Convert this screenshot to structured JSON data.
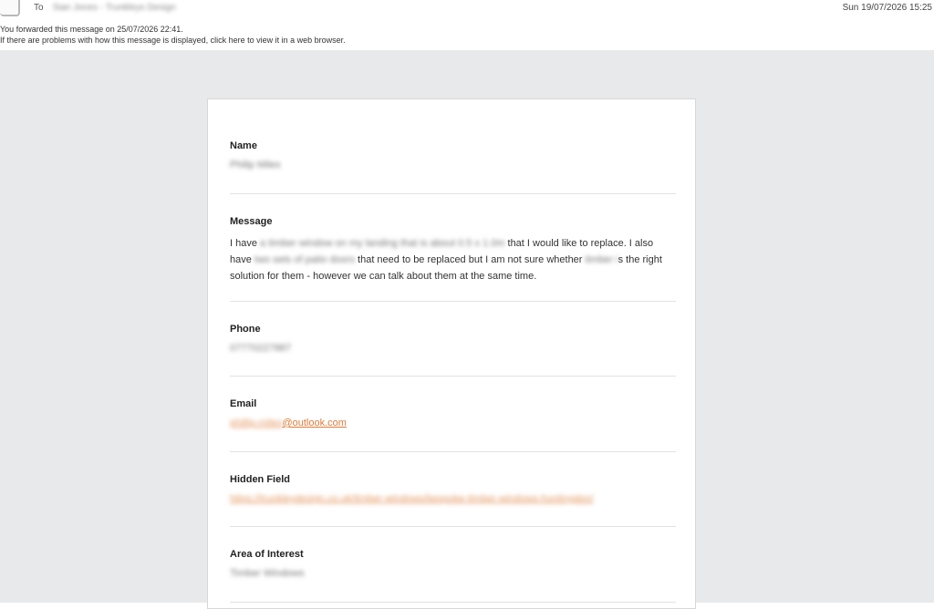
{
  "header": {
    "to_label": "To",
    "recipient": "Sian Jones - Trunkleys Design",
    "date": "Sun 19/07/2026 15:25",
    "forward_note": "You forwarded this message on 25/07/2026 22:41.",
    "display_note": "If there are problems with how this message is displayed, click here to view it in a web browser."
  },
  "form": {
    "name": {
      "label": "Name",
      "value": "Philip Miles"
    },
    "message": {
      "label": "Message",
      "part1": "I have ",
      "blur1": "a timber window on my landing that is about 0.5 x 1.0m",
      "part2": " that I would like to replace. I also have",
      "blur2": " two sets of patio doors ",
      "part3": "that need to be replaced but I am not sure whether",
      "blur3": " timber i",
      "part4": "s the right solution for them - however we can talk about them at the same time."
    },
    "phone": {
      "label": "Phone",
      "value": "07770227887"
    },
    "email": {
      "label": "Email",
      "blur_part": "phillip-miles",
      "visible_part": "@outlook.com"
    },
    "hidden_field": {
      "label": "Hidden Field",
      "value": "https://trunkleydesign.co.uk/timber-windows/bespoke-timber-windows-huntingdon/"
    },
    "area_of_interest": {
      "label": "Area of Interest",
      "value": "Timber Windows"
    }
  }
}
